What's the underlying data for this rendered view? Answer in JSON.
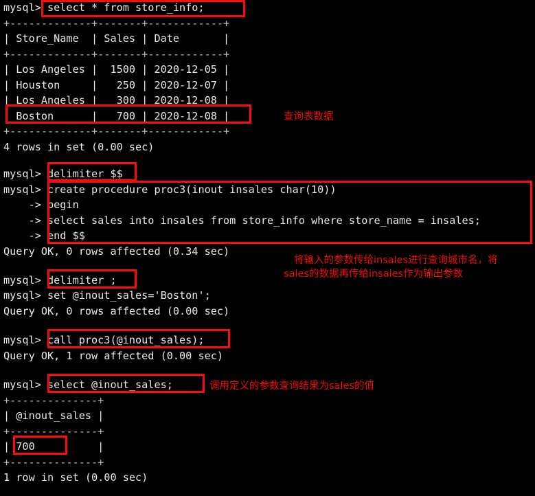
{
  "terminal": {
    "prompt": "mysql>",
    "continuation": "    ->",
    "background_color": "#000000",
    "text_color": "#e8e8e8",
    "highlight_color": "#fb0b0b",
    "lines": {
      "l01": "mysql> select * from store_info;",
      "l02": "+-------------+-------+------------+",
      "l03": "| Store_Name  | Sales | Date       |",
      "l04": "+-------------+-------+------------+",
      "l05": "| Los Angeles |  1500 | 2020-12-05 |",
      "l06": "| Houston     |   250 | 2020-12-07 |",
      "l07": "| Los Angeles |   300 | 2020-12-08 |",
      "l08": "| Boston      |   700 | 2020-12-08 |",
      "l09": "+-------------+-------+------------+",
      "l10": "4 rows in set (0.00 sec)",
      "l11": "mysql> delimiter $$",
      "l12": "mysql> create procedure proc3(inout insales char(10))",
      "l13": "    -> begin",
      "l14": "    -> select sales into insales from store_info where store_name = insales;",
      "l15": "    -> end $$",
      "l16": "Query OK, 0 rows affected (0.34 sec)",
      "l17": "mysql> delimiter ;",
      "l18": "mysql> set @inout_sales='Boston';",
      "l19": "Query OK, 0 rows affected (0.00 sec)",
      "l20": "mysql> call proc3(@inout_sales);",
      "l21": "Query OK, 1 row affected (0.00 sec)",
      "l22": "mysql> select @inout_sales;",
      "l23": "+--------------+",
      "l24": "| @inout_sales |",
      "l25": "+--------------+",
      "l26": "| 700          |",
      "l27": "+--------------+",
      "l28": "1 row in set (0.00 sec)"
    }
  },
  "annotations": {
    "query_table": "查询表数据",
    "param_explain_line1": "将输入的参数传给insales进行查询城市名，将",
    "param_explain_line2": "sales的数据再传给insales作为输出参数",
    "call_result": "调用定义的参数查询结果为sales的值"
  },
  "table_store_info": {
    "columns": [
      "Store_Name",
      "Sales",
      "Date"
    ],
    "rows": [
      [
        "Los Angeles",
        "1500",
        "2020-12-05"
      ],
      [
        "Houston",
        "250",
        "2020-12-07"
      ],
      [
        "Los Angeles",
        "300",
        "2020-12-08"
      ],
      [
        "Boston",
        "700",
        "2020-12-08"
      ]
    ],
    "row_count_text": "4 rows in set (0.00 sec)"
  },
  "table_result": {
    "columns": [
      "@inout_sales"
    ],
    "rows": [
      [
        "700"
      ]
    ],
    "row_count_text": "1 row in set (0.00 sec)"
  }
}
